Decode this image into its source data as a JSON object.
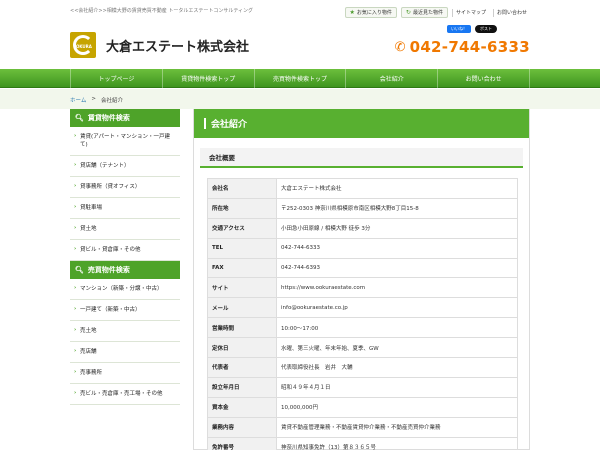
{
  "header": {
    "tagline": "<<会社紹介>>相模大野の賃貸売買不動産 トータルエステートコンサルティング",
    "favorites_label": "お気に入り物件",
    "history_label": "最近見た物件",
    "sitemap_label": "サイトマップ",
    "contact_label": "お問い合わせ",
    "logo_text": "OKURA",
    "company_name": "大倉エステート株式会社",
    "fb_label": "いいね！",
    "x_label": "ポスト",
    "phone": "042-744-6333"
  },
  "nav": {
    "items": [
      "トップページ",
      "賃貸物件検索トップ",
      "売買物件検索トップ",
      "会社紹介",
      "お問い合わせ"
    ]
  },
  "breadcrumb": {
    "home": "ホーム",
    "sep": ">",
    "current": "会社紹介"
  },
  "sidebar": {
    "rent_title": "賃貸物件検索",
    "rent_items": [
      "賃貸(アパート・マンション・一戸建て)",
      "貸店舗（テナント）",
      "貸事務所（貸オフィス）",
      "貸駐車場",
      "貸土地",
      "貸ビル・貸倉庫・その他"
    ],
    "sale_title": "売買物件検索",
    "sale_items": [
      "マンション（新築・分譲・中古）",
      "一戸建て（新築・中古）",
      "売土地",
      "売店舗",
      "売事務所",
      "売ビル・売倉庫・売工場・その他"
    ]
  },
  "main": {
    "title": "会社紹介",
    "subtitle": "会社概要",
    "rows": [
      {
        "k": "会社名",
        "v": "大倉エステート株式会社"
      },
      {
        "k": "所在地",
        "v": "〒252-0303 神奈川県相模原市南区相模大野8丁目15-8"
      },
      {
        "k": "交通アクセス",
        "v": "小田急小田原線 / 相模大野 徒歩 3分"
      },
      {
        "k": "TEL",
        "v": "042-744-6333"
      },
      {
        "k": "FAX",
        "v": "042-744-6393"
      },
      {
        "k": "サイト",
        "v": "https://www.ookuraestate.com"
      },
      {
        "k": "メール",
        "v": "info@ookuraestate.co.jp"
      },
      {
        "k": "営業時間",
        "v": "10:00～17:00"
      },
      {
        "k": "定休日",
        "v": "水曜、第三火曜、年末年始、夏季、GW"
      },
      {
        "k": "代表者",
        "v": "代表取締役社長　岩井　大輔"
      },
      {
        "k": "設立年月日",
        "v": "昭和４９年４月１日"
      },
      {
        "k": "資本金",
        "v": "10,000,000円"
      },
      {
        "k": "業務内容",
        "v": "賃貸不動産管理業務・不動産賃貸仲介業務・不動産売買仲介業務"
      },
      {
        "k": "免許番号",
        "v": "神奈川県知事免許（13）第８３６５号"
      }
    ]
  },
  "colors": {
    "accent_green": "#58b030",
    "phone_orange": "#f07800",
    "logo_gold": "#c6a400"
  },
  "icons": [
    "star-icon",
    "history-icon",
    "phone-icon",
    "search-icon",
    "chevron-right-icon"
  ]
}
